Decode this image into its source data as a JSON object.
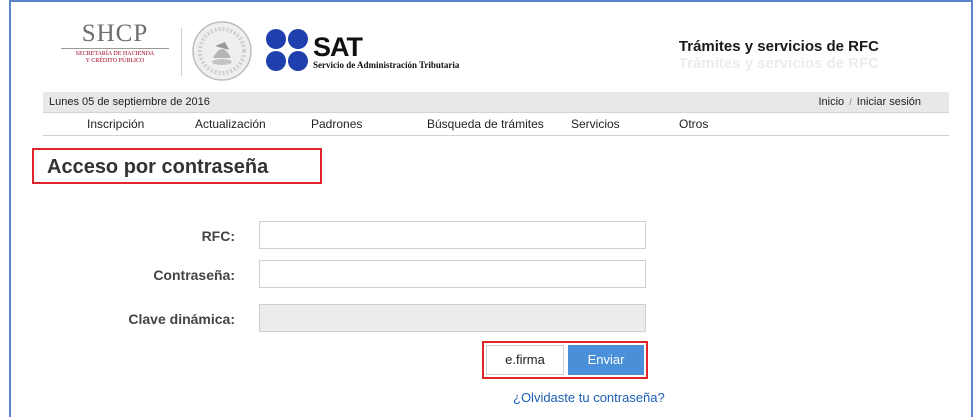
{
  "header": {
    "shcp": {
      "title": "SHCP",
      "line1": "SECRETARÍA DE HACIENDA",
      "line2": "Y CRÉDITO PÚBLICO"
    },
    "sat": {
      "logo_text": "SAT",
      "subtitle": "Servicio de Administración Tributaria"
    },
    "site_title": "Trámites y servicios de RFC",
    "site_title_shadow": "Trámites y servicios de RFC"
  },
  "datebar": {
    "date": "Lunes 05 de septiembre de 2016",
    "home_link": "Inicio",
    "separator": "/",
    "login_link": "Iniciar sesión"
  },
  "nav": {
    "items": [
      {
        "label": "Inscripción"
      },
      {
        "label": "Actualización"
      },
      {
        "label": "Padrones"
      },
      {
        "label": "Búsqueda de trámites"
      },
      {
        "label": "Servicios"
      },
      {
        "label": "Otros"
      }
    ]
  },
  "main": {
    "title": "Acceso por contraseña",
    "fields": {
      "rfc": {
        "label": "RFC:",
        "value": ""
      },
      "password": {
        "label": "Contraseña:",
        "value": ""
      },
      "dynamic_key": {
        "label": "Clave dinámica:",
        "value": ""
      }
    },
    "buttons": {
      "efirma": "e.firma",
      "submit": "Enviar"
    },
    "forgot_link": "¿Olvidaste tu contraseña?"
  },
  "colors": {
    "frame_border": "#5b86c9",
    "highlight_red": "#e0242b",
    "button_blue": "#4a90d9",
    "link_blue": "#1a5fb4",
    "datebar_bg": "#e8e8e8",
    "sat_logo_blue": "#1f3fae"
  },
  "icons": {
    "shcp_seal": "mexican-coat-of-arms-icon",
    "sat_dots": "sat-logo-icon"
  }
}
